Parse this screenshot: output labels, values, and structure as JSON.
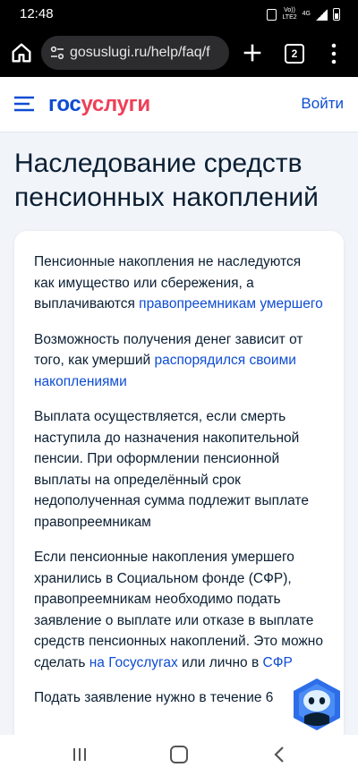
{
  "status_bar": {
    "time": "12:48",
    "volte_top": "Vo))",
    "volte_bottom": "LTE2",
    "network": "4G"
  },
  "browser": {
    "url": "gosuslugi.ru/help/faq/f",
    "tab_count": "2"
  },
  "header": {
    "logo_part1": "гос",
    "logo_part2": "услуги",
    "login_label": "Войти",
    "logo_colors": {
      "gos": "#0d4cd3",
      "uslugi": "#ee3f58"
    }
  },
  "page": {
    "title": "Наследование средств пенсионных накоплений",
    "paragraphs": [
      {
        "text": "Пенсионные накопления не наследуются как имущество или сбережения, а выплачиваются ",
        "link": "правопреемникам умершего"
      },
      {
        "text": "Возможность получения денег зависит от того, как умерший ",
        "link": "распорядился своими накоплениями"
      },
      {
        "text": "Выплата осуществляется, если смерть наступила до назначения накопительной пенсии. При оформлении пенсионной выплаты на определённый срок недополученная сумма подлежит выплате правопреемникам"
      },
      {
        "text": "Если пенсионные накопления умершего хранились в Социальном фонде (СФР), правопреемникам необходимо подать заявление о выплате или отказе в выплате средств пенсионных накоплений. Это можно сделать ",
        "link": "на Госуслугах",
        "text_after": " или лично в ",
        "link2": "СФР"
      },
      {
        "text": "Подать заявление нужно в течение 6"
      }
    ]
  },
  "colors": {
    "accent": "#0d4cd3",
    "page_bg": "#f1f4f9",
    "text": "#0b1f33"
  },
  "icons": {
    "home": "home-icon",
    "site_settings": "tune-icon",
    "new_tab": "plus-icon",
    "menu": "more-vert-icon",
    "burger": "menu-icon",
    "assistant": "robot-assistant-icon"
  }
}
